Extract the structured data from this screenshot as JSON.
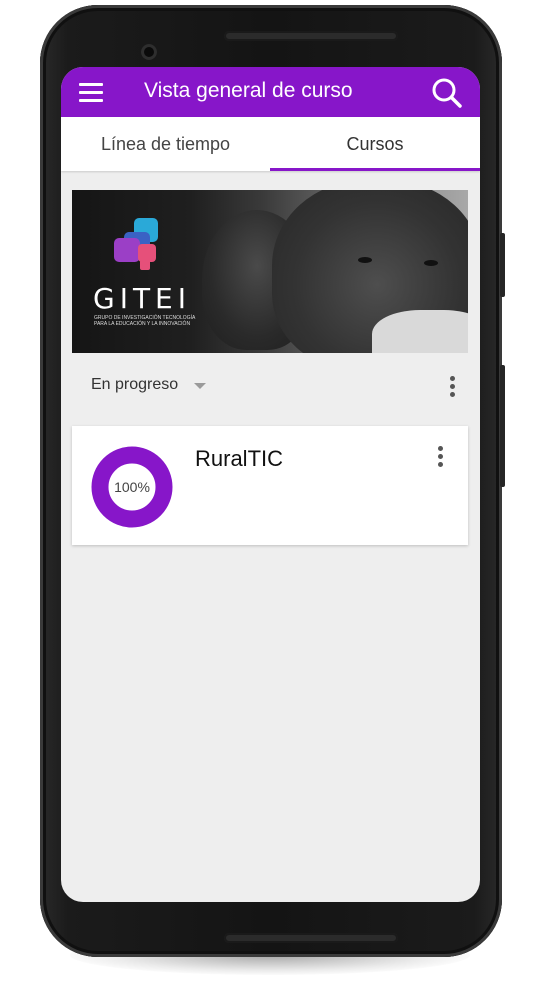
{
  "appbar": {
    "title": "Vista general de curso",
    "accent_color": "#8716c9",
    "menu_icon": "hamburger-menu-icon",
    "search_icon": "search-icon"
  },
  "tabs": [
    {
      "label": "Línea de tiempo",
      "active": false
    },
    {
      "label": "Cursos",
      "active": true
    }
  ],
  "banner": {
    "logo_text": "GITEI",
    "logo_subtext": "GRUPO DE INVESTIGACIÓN TECNOLOGÍA PARA LA EDUCACIÓN Y LA INNOVACIÓN"
  },
  "filter": {
    "selected": "En progreso",
    "more_icon": "more-vert-icon"
  },
  "courses": [
    {
      "name": "RuralTIC",
      "progress_label": "100%",
      "progress": 1.0
    }
  ]
}
